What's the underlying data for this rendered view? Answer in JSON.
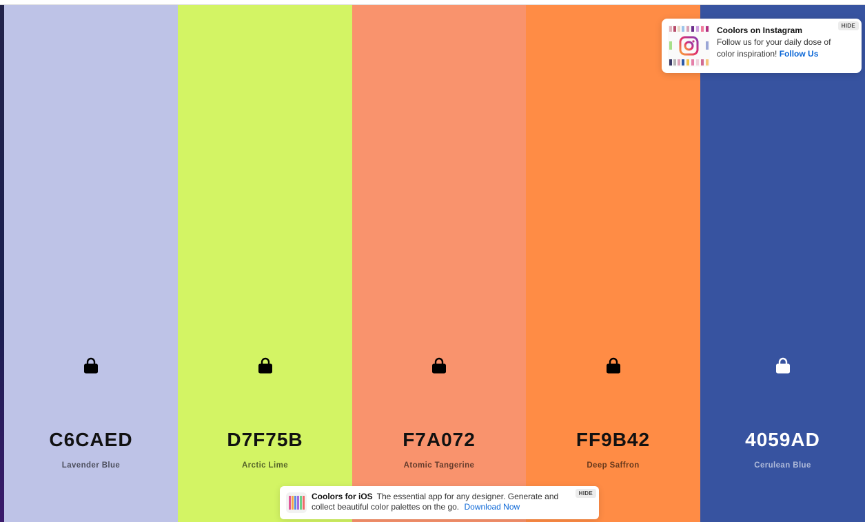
{
  "palette": [
    {
      "hex": "C6CAED",
      "name": "Lavender Blue",
      "color": "#BEC3E7",
      "text": "dark"
    },
    {
      "hex": "D7F75B",
      "name": "Arctic Lime",
      "color": "#D3F464",
      "text": "dark"
    },
    {
      "hex": "F7A072",
      "name": "Atomic Tangerine",
      "color": "#F9936D",
      "text": "dark"
    },
    {
      "hex": "FF9B42",
      "name": "Deep Saffron",
      "color": "#FF8C45",
      "text": "dark"
    },
    {
      "hex": "4059AD",
      "name": "Cerulean Blue",
      "color": "#3753A0",
      "text": "light"
    }
  ],
  "icons": {
    "lock": "lock-icon",
    "instagram": "instagram-icon"
  },
  "instagram_toast": {
    "title": "Coolors on Instagram",
    "body": "Follow us for your daily dose of color inspiration!",
    "link": "Follow Us",
    "hide": "HIDE"
  },
  "ios_toast": {
    "title": "Coolors for iOS",
    "body": "The essential app for any designer. Generate and collect beautiful color palettes on the go.",
    "link": "Download Now",
    "hide": "HIDE"
  },
  "colors": {
    "link": "#0A66D6"
  }
}
